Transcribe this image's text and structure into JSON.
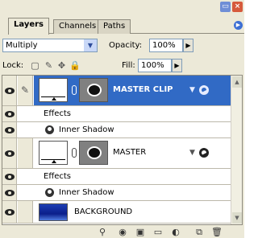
{
  "panel": {
    "tabs": [
      {
        "label": "Layers"
      },
      {
        "label": "Channels"
      },
      {
        "label": "Paths"
      }
    ]
  },
  "blend": {
    "mode": "Multiply",
    "opacity_label": "Opacity:",
    "opacity_value": "100%"
  },
  "lock": {
    "label": "Lock:",
    "fill_label": "Fill:",
    "fill_value": "100%"
  },
  "layers": [
    {
      "name": "MASTER CLIP",
      "selected": true,
      "effects_label": "Effects",
      "effect": "Inner Shadow"
    },
    {
      "name": "MASTER",
      "selected": false,
      "effects_label": "Effects",
      "effect": "Inner Shadow"
    },
    {
      "name": "BACKGROUND",
      "selected": false
    }
  ],
  "colors": {
    "selection": "#316ac5",
    "panel_bg": "#ece9d8"
  },
  "icons": {
    "eye": "eye-icon",
    "brush": "brush-icon",
    "chain": "chain-link-icon",
    "fx": "fx-icon",
    "lock_transparent": "lock-transparency-icon",
    "lock_paint": "lock-paint-icon",
    "lock_move": "lock-move-icon",
    "lock_all": "lock-all-icon"
  }
}
